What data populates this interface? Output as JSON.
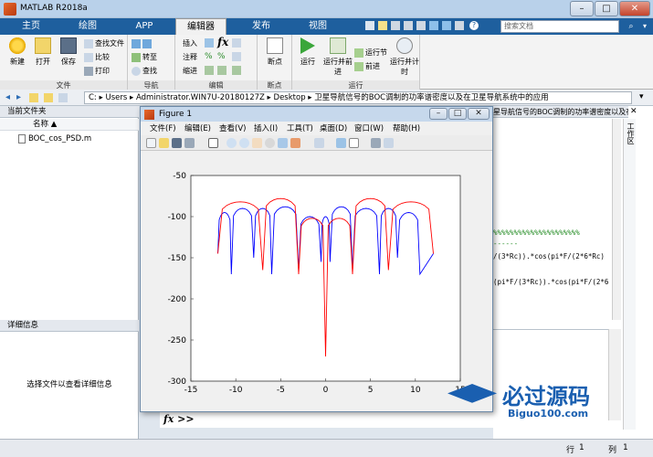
{
  "window": {
    "title": "MATLAB R2018a"
  },
  "tabs": [
    {
      "label": "主页"
    },
    {
      "label": "绘图"
    },
    {
      "label": "APP"
    },
    {
      "label": "编辑器"
    },
    {
      "label": "发布"
    },
    {
      "label": "视图"
    }
  ],
  "search": {
    "placeholder": "搜索文档"
  },
  "ribbon": {
    "file_group": {
      "label": "文件",
      "new": "新建",
      "open": "打开",
      "save": "保存",
      "find_files": "查找文件",
      "compare": "比较",
      "print": "打印"
    },
    "nav_group": {
      "label": "导航",
      "goto": "转至",
      "find": "查找"
    },
    "edit_group": {
      "label": "编辑",
      "insert": "插入",
      "comment": "注释",
      "indent": "缩进"
    },
    "breakpoints_group": {
      "label": "断点",
      "breakpoints": "断点"
    },
    "run_group": {
      "label": "运行",
      "run": "运行",
      "run_advance": "运行并前进",
      "run_section": "运行节",
      "advance": "前进",
      "run_time": "运行并计时"
    }
  },
  "address": {
    "path": "C: ▸ Users ▸ Administrator.WIN7U-20180127Z ▸ Desktop ▸ 卫星导航信号的BOC调制的功率谱密度以及在卫星导航系统中的应用"
  },
  "left_pane": {
    "header": "当前文件夹",
    "column_name": "名称 ▲",
    "files": [
      {
        "name": "BOC_cos_PSD.m"
      }
    ],
    "details_header": "详细信息",
    "details_hint": "选择文件以查看详细信息"
  },
  "right_pane": {
    "tab_title": "星导航信号的BOC调制的功率谱密度以及在卫星导航...",
    "workspace_label": "工作区",
    "code_lines": [
      "%%%%%%%%%%%%%%%%%%%%%",
      "------",
      "/(3*Rc)).*cos(pi*F/(2*6*Rc)",
      "(pi*F/(3*Rc)).*cos(pi*F/(2*6"
    ]
  },
  "figure": {
    "title": "Figure 1",
    "menu": [
      "文件(F)",
      "编辑(E)",
      "查看(V)",
      "插入(I)",
      "工具(T)",
      "桌面(D)",
      "窗口(W)",
      "帮助(H)"
    ]
  },
  "chart_data": {
    "type": "line",
    "title": "",
    "xlabel": "",
    "ylabel": "",
    "xlim": [
      -15,
      15
    ],
    "ylim": [
      -300,
      -50
    ],
    "xticks": [
      -15,
      -10,
      -5,
      0,
      5,
      10,
      15
    ],
    "yticks": [
      -50,
      -100,
      -150,
      -200,
      -250,
      -300
    ],
    "series": [
      {
        "color": "#0000ff",
        "lobe_centers": [
          -11.25,
          -9.25,
          -7,
          -4.5,
          -1.75,
          1.75,
          4.5,
          7,
          9.25,
          11.25
        ],
        "peaks": [
          -95,
          -90,
          -90,
          -88,
          -100,
          -100,
          -88,
          -90,
          -90,
          -95
        ],
        "nulls": [
          -12,
          -10.5,
          -8,
          -6,
          -3,
          -0.5,
          0.5,
          3,
          6,
          8,
          10.5,
          12
        ],
        "null_depth": [
          -145,
          -170,
          -150,
          -170,
          -165,
          -155,
          -155,
          -165,
          -170,
          -150,
          -170,
          -145
        ]
      },
      {
        "color": "#ff0000",
        "lobe_centers": [
          -9.75,
          -4.5,
          -1.25,
          1.25,
          4.5,
          9.75
        ],
        "peaks": [
          -82,
          -78,
          -102,
          -102,
          -78,
          -82
        ],
        "nulls": [
          -12,
          -7,
          -3,
          0,
          3,
          7,
          12
        ],
        "null_depth": [
          -145,
          -165,
          -170,
          -270,
          -170,
          -165,
          -145
        ]
      }
    ]
  },
  "command": {
    "prompt": "fx >>"
  },
  "status": {
    "line_label": "行",
    "line_value": "1",
    "col_label": "列",
    "col_value": "1"
  },
  "watermark": {
    "logo_text": "必过源码",
    "site": "Biguo100.com"
  }
}
